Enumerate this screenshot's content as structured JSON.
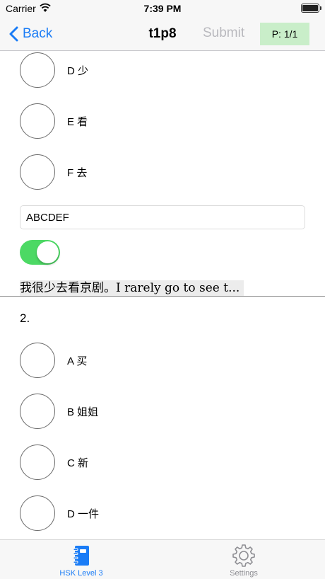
{
  "status_bar": {
    "carrier": "Carrier",
    "time": "7:39 PM",
    "wifi_icon": "wifi-icon",
    "battery_icon": "battery-icon"
  },
  "nav": {
    "back_label": "Back",
    "title": "t1p8",
    "submit_label": "Submit",
    "page_indicator": "P: 1/1",
    "accent_color": "#1a7cf6",
    "badge_color": "#c9eec9"
  },
  "question1": {
    "options": [
      {
        "label": "D 少"
      },
      {
        "label": "E 看"
      },
      {
        "label": "F 去"
      }
    ],
    "answer_value": "ABCDEF",
    "show_translation": true,
    "translation": "我很少去看京剧。I rarely go to see t..."
  },
  "question2": {
    "number": "2.",
    "options": [
      {
        "label": "A 买"
      },
      {
        "label": "B 姐姐"
      },
      {
        "label": "C 新"
      },
      {
        "label": "D 一件"
      }
    ]
  },
  "tab_bar": {
    "tabs": [
      {
        "label": "HSK Level 3",
        "icon": "notebook-icon",
        "active": true
      },
      {
        "label": "Settings",
        "icon": "gear-icon",
        "active": false
      }
    ]
  },
  "colors": {
    "toggle_on": "#4cd964",
    "tab_active": "#1a7cf6",
    "tab_inactive": "#8e8e93"
  }
}
